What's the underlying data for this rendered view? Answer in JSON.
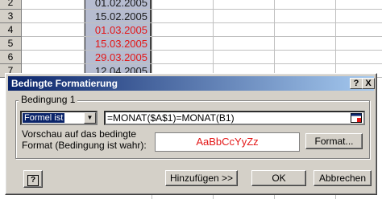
{
  "sheet": {
    "rows": [
      {
        "num": "2",
        "value": "01.02.2005",
        "highlight": false
      },
      {
        "num": "3",
        "value": "15.02.2005",
        "highlight": false
      },
      {
        "num": "4",
        "value": "01.03.2005",
        "highlight": true
      },
      {
        "num": "5",
        "value": "15.03.2005",
        "highlight": true
      },
      {
        "num": "6",
        "value": "29.03.2005",
        "highlight": true
      },
      {
        "num": "7",
        "value": "12.04.2005",
        "highlight": false
      }
    ]
  },
  "dialog": {
    "title": "Bedingte Formatierung",
    "help_label": "?",
    "close_label": "X",
    "condition_group_label": "Bedingung 1",
    "condition_type_value": "Formel ist",
    "formula_value": "=MONAT($A$1)=MONAT(B1)",
    "preview_label": "Vorschau auf das bedingte Format (Bedingung ist wahr):",
    "preview_text": "AaBbCcYyZz",
    "format_button": "Format...",
    "add_button": "Hinzufügen >>",
    "ok_button": "OK",
    "cancel_button": "Abbrechen",
    "help_icon_label": "?"
  },
  "colors": {
    "title_gradient_start": "#0a246a",
    "preview_text_color": "#e31616",
    "selected_cells": "#b6bcd0",
    "highlight_text": "#e31616"
  }
}
